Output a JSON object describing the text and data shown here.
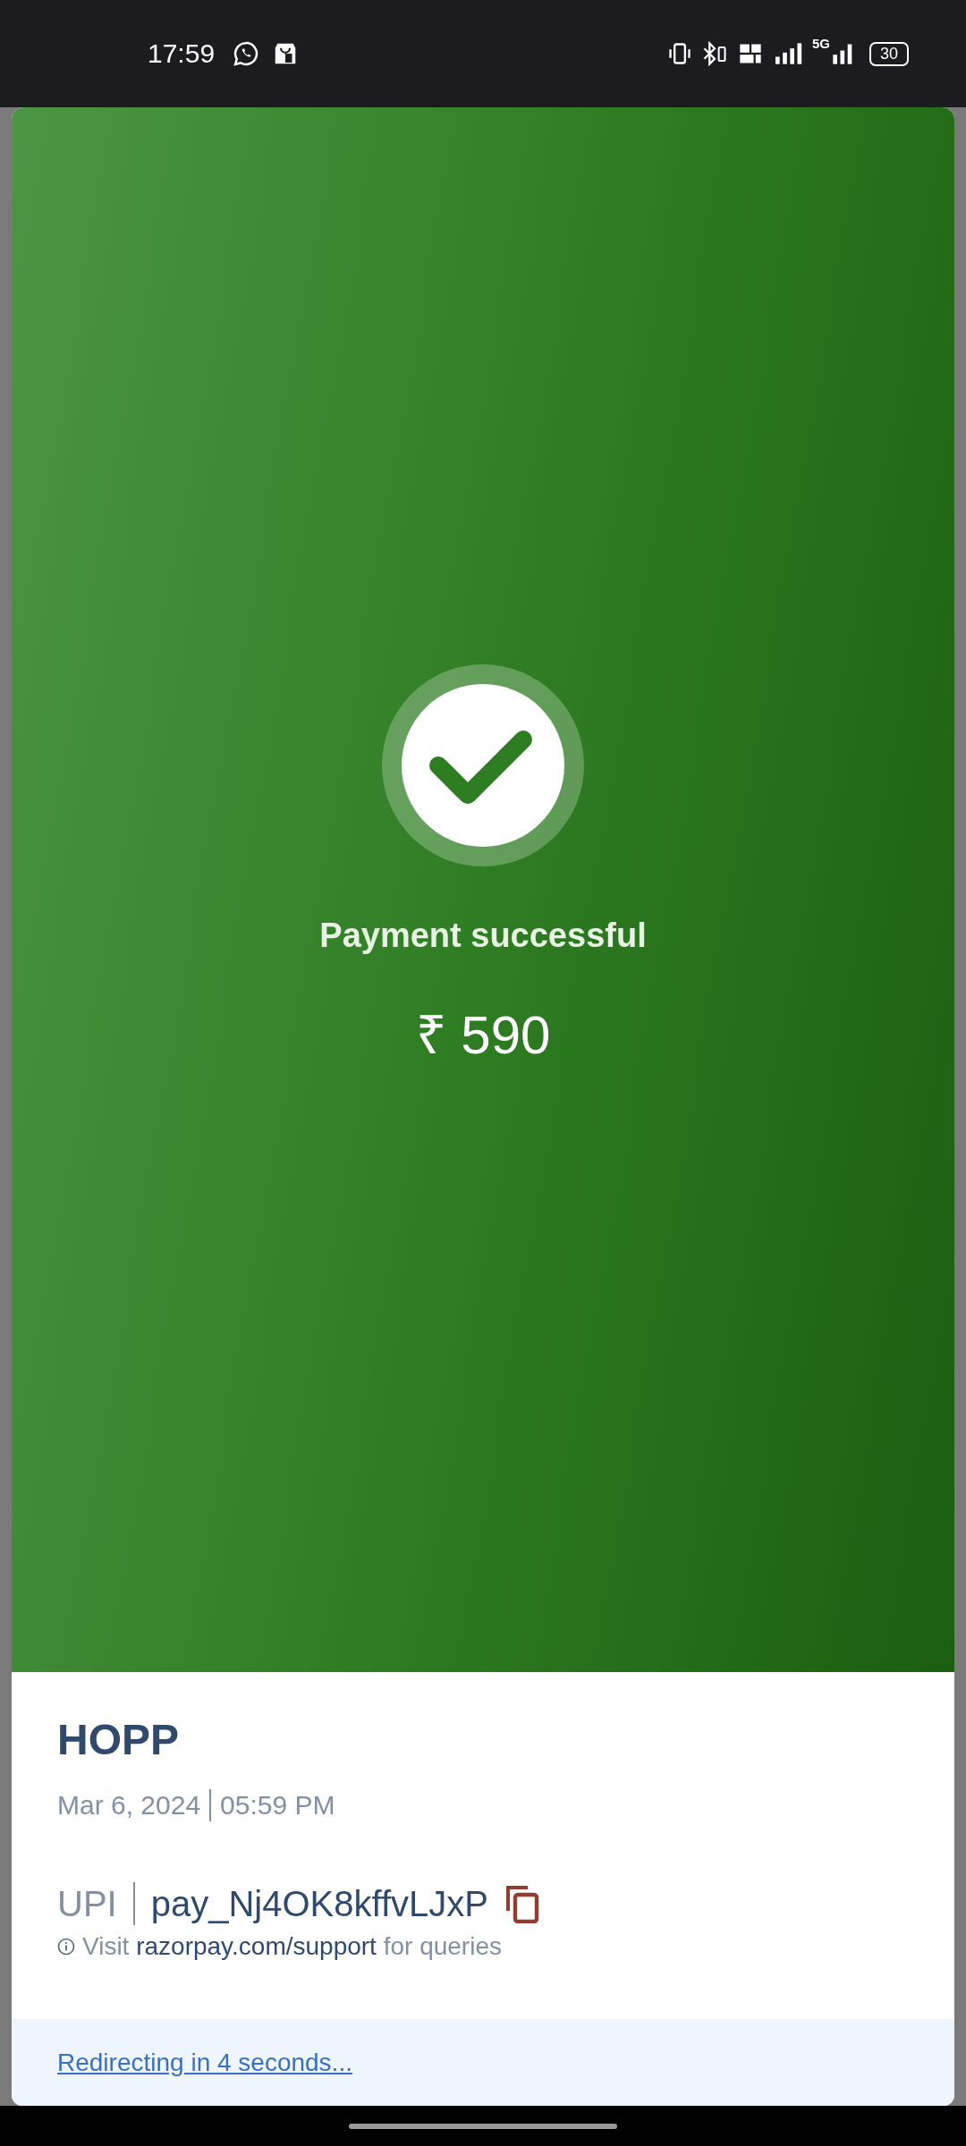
{
  "status_bar": {
    "time": "17:59",
    "network": "5G",
    "battery": "30"
  },
  "payment": {
    "status": "Payment successful",
    "amount": "₹ 590"
  },
  "merchant": {
    "name": "HOPP",
    "date": "Mar 6, 2024",
    "time": "05:59 PM"
  },
  "transaction": {
    "method": "UPI",
    "payment_id": "pay_Nj4OK8kffvLJxP"
  },
  "support": {
    "prefix": "Visit",
    "link": "razorpay.com/support",
    "suffix": "for queries"
  },
  "redirect": {
    "text": "Redirecting in 4 seconds..."
  }
}
